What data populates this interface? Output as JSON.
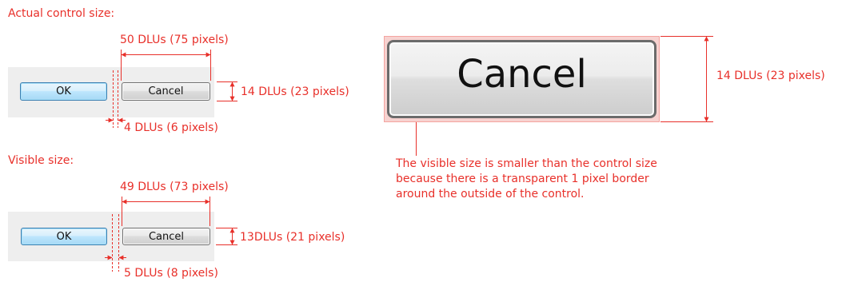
{
  "sections": {
    "actual_title": "Actual control size:",
    "visible_title": "Visible size:"
  },
  "buttons": {
    "ok_label": "OK",
    "cancel_label": "Cancel",
    "zoom_label": "Cancel"
  },
  "dimensions": {
    "actual_width": "50 DLUs (75 pixels)",
    "actual_height": "14 DLUs (23 pixels)",
    "actual_spacing": "4 DLUs (6 pixels)",
    "visible_width": "49 DLUs (73 pixels)",
    "visible_height": "13DLUs (21 pixels)",
    "visible_spacing": "5 DLUs (8 pixels)",
    "zoom_height": "14 DLUs (23 pixels)"
  },
  "note": "The visible size is smaller than the control size because there is a transparent 1 pixel border around the outside of the control.",
  "colors": {
    "annotation": "#e8302a",
    "panel": "#eeeeee"
  }
}
